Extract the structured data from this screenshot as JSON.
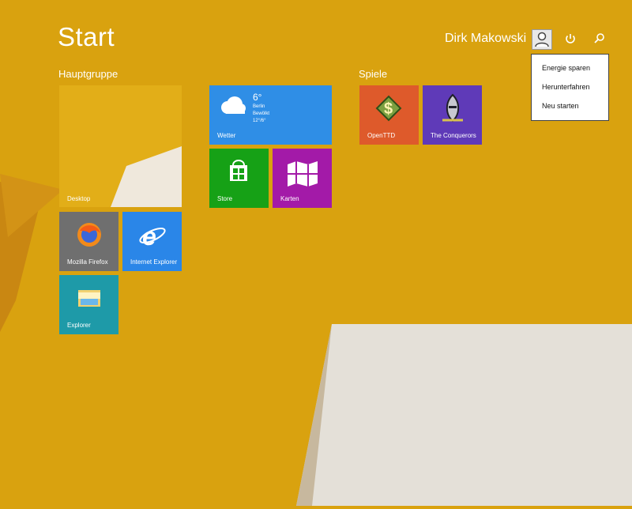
{
  "header": {
    "title": "Start",
    "user_name": "Dirk Makowski",
    "power_icon": "power-icon",
    "search_icon": "search-icon"
  },
  "groups": {
    "main": "Hauptgruppe",
    "games": "Spiele"
  },
  "tiles": {
    "desktop": "Desktop",
    "firefox": "Mozilla Firefox",
    "ie": "Internet Explorer",
    "explorer": "Explorer",
    "weather": "Wetter",
    "store": "Store",
    "maps": "Karten",
    "openttd": "OpenTTD",
    "conquerors": "The Conquerors"
  },
  "weather": {
    "temperature": "6°",
    "city": "Berlin",
    "condition": "Bewölkt",
    "range": "12°/6°"
  },
  "power_menu": {
    "items": [
      "Energie sparen",
      "Herunterfahren",
      "Neu starten"
    ]
  },
  "colors": {
    "background": "#d9a20f",
    "weather": "#2f8ee6",
    "store": "#16a116",
    "maps": "#a31aa8",
    "ie": "#2a86e8",
    "explorer": "#1e9aa8",
    "firefox": "#6f6f6f",
    "openttd": "#de5a2b",
    "conquerors": "#5f3ab8"
  }
}
